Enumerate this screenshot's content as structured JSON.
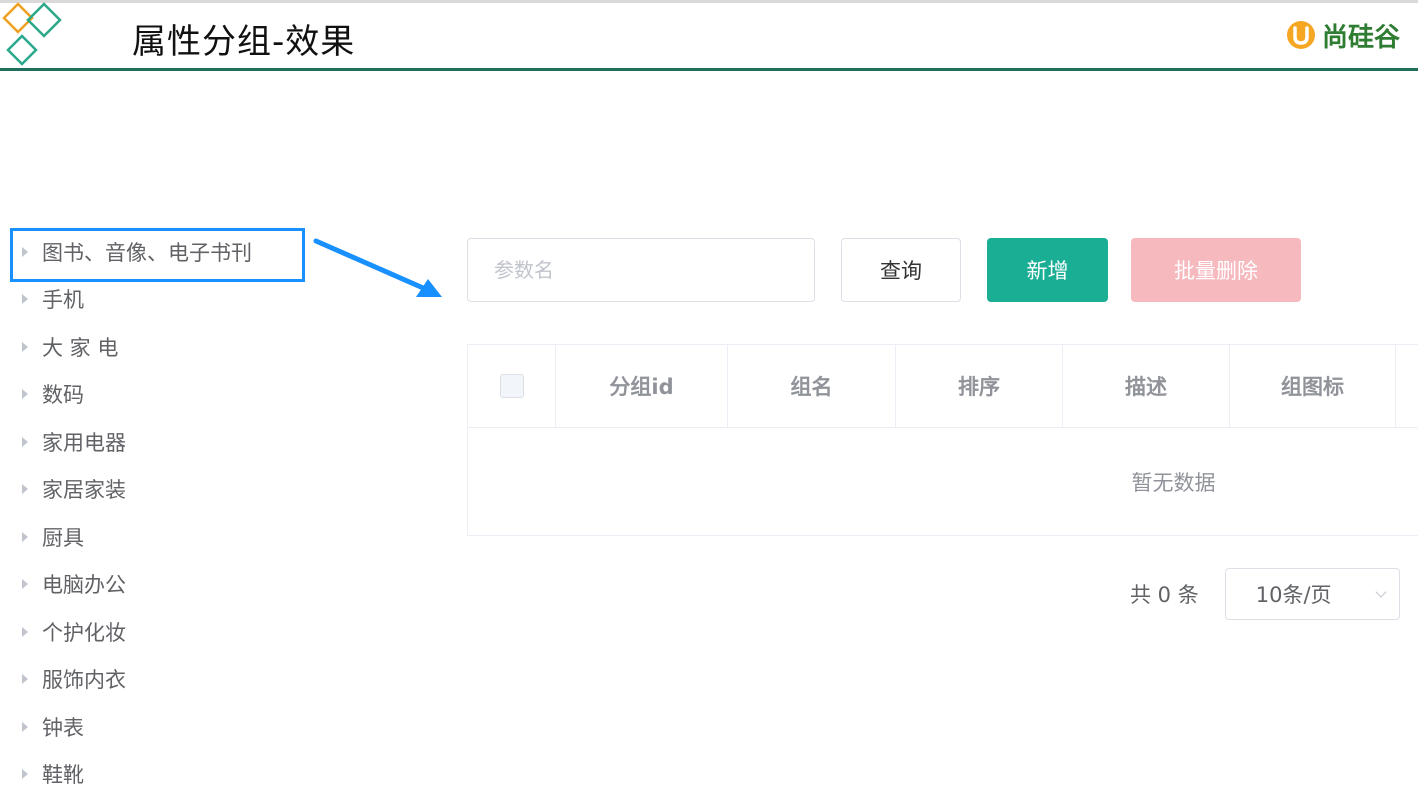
{
  "header": {
    "title": "属性分组-效果",
    "brand_text": "尚硅谷"
  },
  "tree": {
    "items": [
      {
        "label": "图书、音像、电子书刊"
      },
      {
        "label": "手机"
      },
      {
        "label": "大 家 电"
      },
      {
        "label": "数码"
      },
      {
        "label": "家用电器"
      },
      {
        "label": "家居家装"
      },
      {
        "label": "厨具"
      },
      {
        "label": "电脑办公"
      },
      {
        "label": "个护化妆"
      },
      {
        "label": "服饰内衣"
      },
      {
        "label": "钟表"
      },
      {
        "label": "鞋靴"
      }
    ]
  },
  "toolbar": {
    "search_placeholder": "参数名",
    "query_label": "查询",
    "add_label": "新增",
    "batch_delete_label": "批量删除"
  },
  "table": {
    "columns": [
      "分组id",
      "组名",
      "排序",
      "描述",
      "组图标"
    ],
    "empty_text": "暂无数据"
  },
  "pagination": {
    "total_text": "共 0 条",
    "page_size_label": "10条/页"
  },
  "colors": {
    "accent": "#1aae94",
    "danger_disabled": "#f6b9be",
    "header_rule": "#1f6f5c",
    "highlight_box": "#1890ff"
  }
}
